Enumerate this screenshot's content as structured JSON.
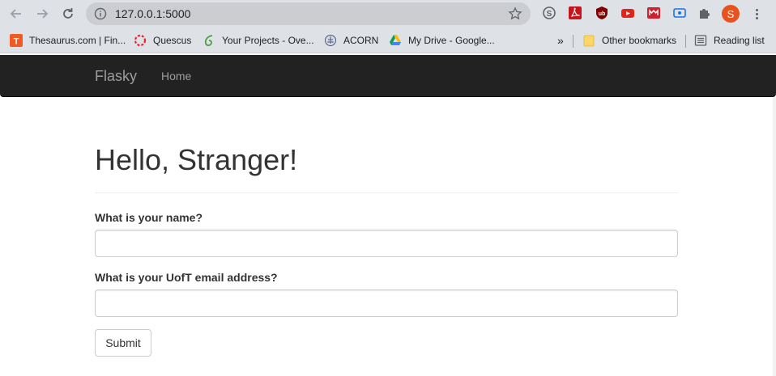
{
  "browser": {
    "url": "127.0.0.1:5000",
    "bookmarks": [
      {
        "label": "Thesaurus.com | Fin...",
        "icon": "thesaurus-icon"
      },
      {
        "label": "Quescus",
        "icon": "quercus-icon"
      },
      {
        "label": "Your Projects - Ove...",
        "icon": "overleaf-icon"
      },
      {
        "label": "ACORN",
        "icon": "acorn-icon"
      },
      {
        "label": "My Drive - Google...",
        "icon": "google-drive-icon"
      }
    ],
    "overflow_label": "»",
    "other_bookmarks": "Other bookmarks",
    "reading_list": "Reading list",
    "avatar_letter": "S"
  },
  "navbar": {
    "brand": "Flasky",
    "home": "Home"
  },
  "page": {
    "title": "Hello, Stranger!",
    "name_label": "What is your name?",
    "name_value": "",
    "email_label": "What is your UofT email address?",
    "email_value": "",
    "submit_label": "Submit"
  },
  "colors": {
    "navbar_bg": "#222222",
    "navbar_text": "#9d9d9d",
    "avatar_bg": "#e8521e"
  }
}
